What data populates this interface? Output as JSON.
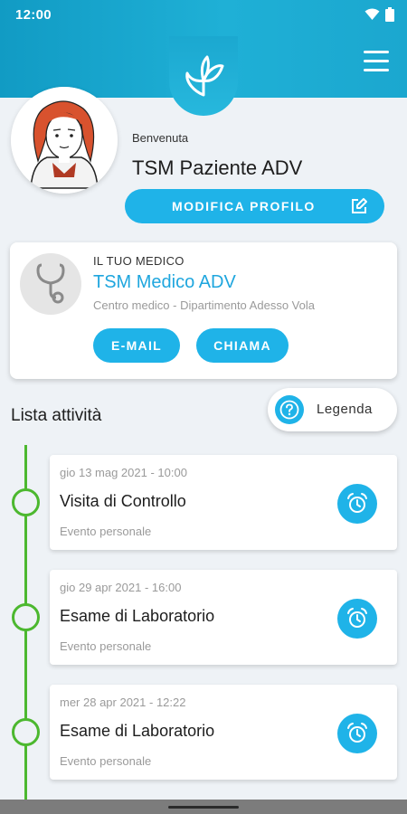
{
  "status_bar": {
    "time": "12:00"
  },
  "header": {
    "logo": "butterfly-logo",
    "menu_icon": "hamburger-menu-icon"
  },
  "profile": {
    "greeting": "Benvenuta",
    "name": "TSM Paziente ADV",
    "edit_button": "MODIFICA PROFILO"
  },
  "doctor": {
    "label": "IL TUO MEDICO",
    "name": "TSM Medico ADV",
    "department": "Centro medico - Dipartimento Adesso Vola",
    "email_button": "E-MAIL",
    "call_button": "CHIAMA"
  },
  "activities": {
    "title": "Lista attività",
    "legend_button": "Legenda",
    "items": [
      {
        "date": "gio 13 mag 2021 - 10:00",
        "title": "Visita di Controllo",
        "type": "Evento personale"
      },
      {
        "date": "gio 29 apr 2021 - 16:00",
        "title": "Esame di Laboratorio",
        "type": "Evento personale"
      },
      {
        "date": "mer 28 apr 2021 - 12:22",
        "title": "Esame di Laboratorio",
        "type": "Evento personale"
      }
    ]
  },
  "colors": {
    "accent": "#1fb3e8",
    "header": "#1ba7cf",
    "timeline": "#4cb82f",
    "doctor_name": "#1fa6de"
  }
}
